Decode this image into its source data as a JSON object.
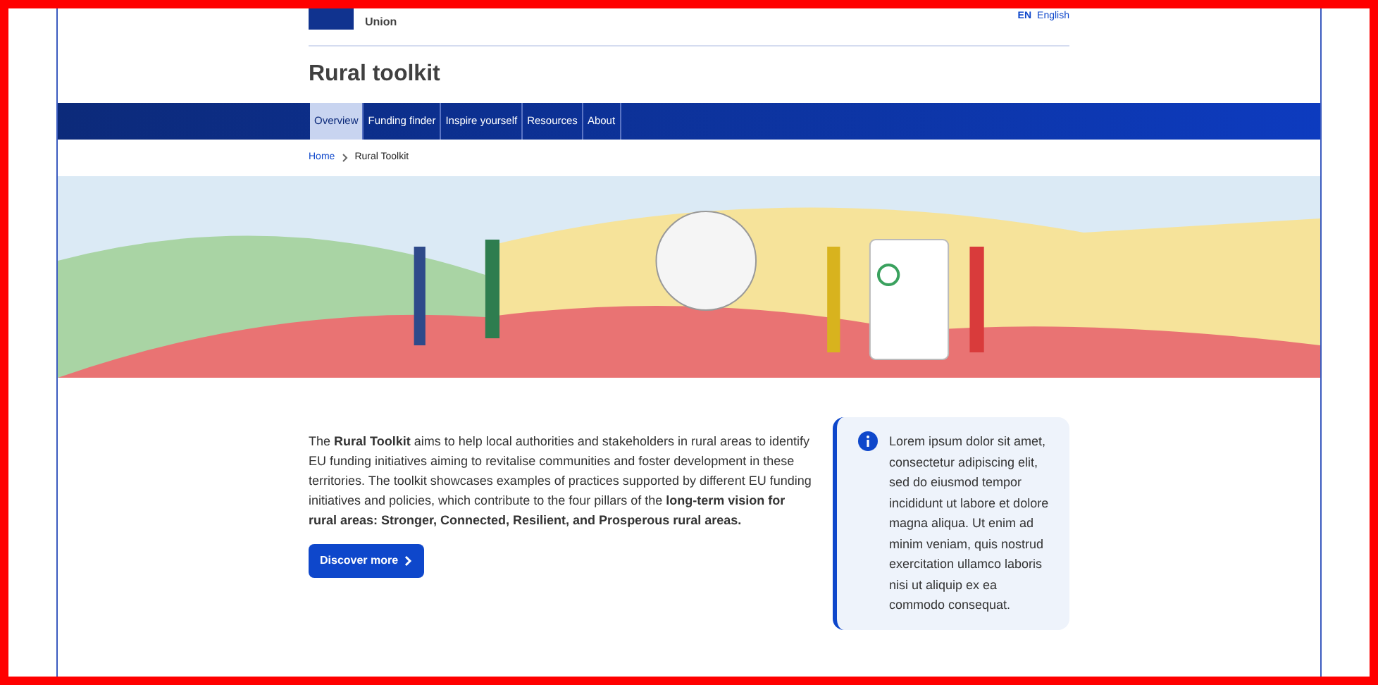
{
  "header": {
    "logo_text": "Union",
    "language_code": "EN",
    "language": "English",
    "site_title": "Rural toolkit"
  },
  "nav": [
    {
      "label": "Overview",
      "selected": true
    },
    {
      "label": "Funding finder",
      "selected": false
    },
    {
      "label": "Inspire yourself",
      "selected": false
    },
    {
      "label": "Resources",
      "selected": false
    },
    {
      "label": "About",
      "selected": false
    }
  ],
  "breadcrumb": [
    {
      "label": "Home",
      "kind": "link"
    },
    {
      "label": "Rural Toolkit",
      "kind": "current"
    }
  ],
  "intro": {
    "text": "The **Rural Toolkit** aims to help local authorities and stakeholders in rural areas to identify EU funding initiatives aiming to revitalise communities and foster development in these territories. The toolkit showcases examples of practices supported by different EU funding initiatives and policies, which contribute to the four pillars of the **long-term vision for rural areas: Stronger, Connected, Resilient, and Prosperous rural areas.**",
    "button": "Discover more"
  },
  "info_box": {
    "text": "Lorem ipsum dolor sit amet, consectetur adipiscing elit, sed do eiusmod tempor incididunt ut labore et dolore magna aliqua. Ut enim ad minim veniam, quis nostrud exercitation ullamco laboris nisi ut aliquip ex ea commodo consequat."
  }
}
